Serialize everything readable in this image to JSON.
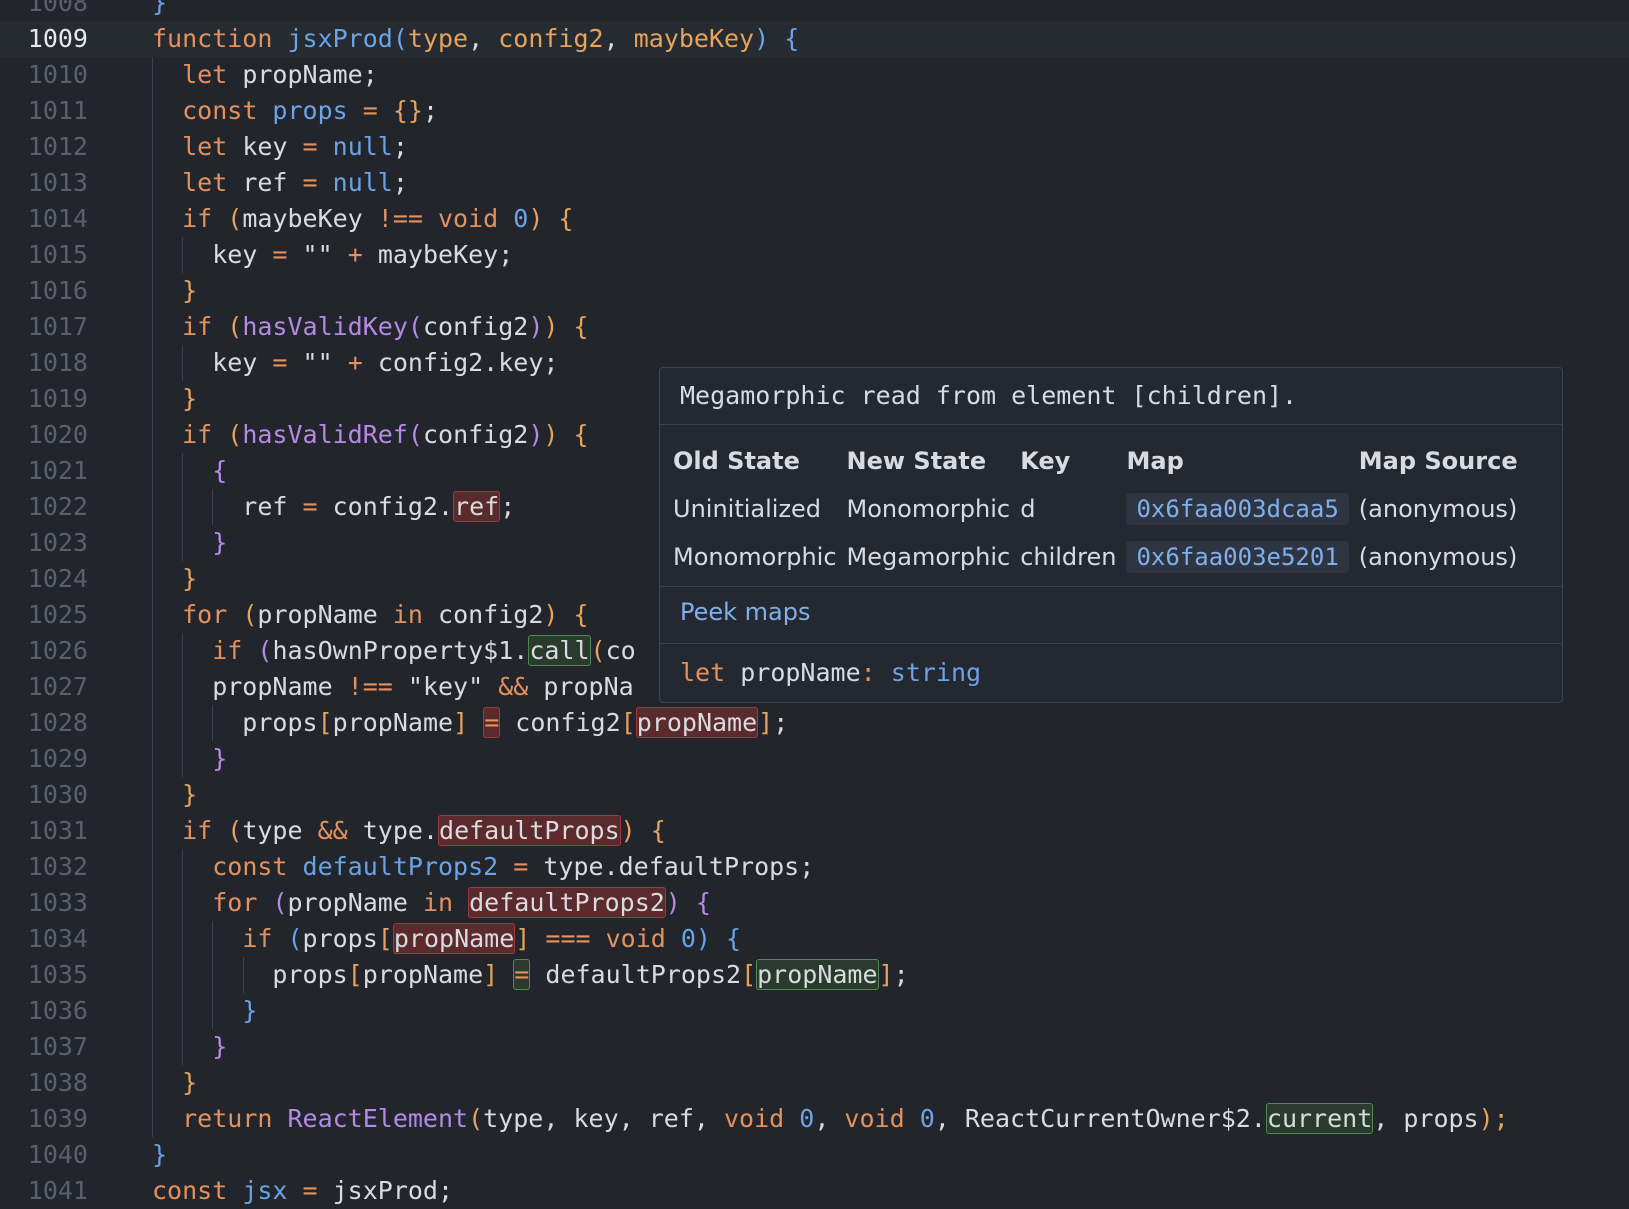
{
  "editor": {
    "current_line": 1009,
    "lines": [
      {
        "n": "1008",
        "code": [
          {
            "t": "}",
            "c": "fn"
          }
        ]
      },
      {
        "n": "1009",
        "code": [
          {
            "t": "function ",
            "c": "kw"
          },
          {
            "t": "jsxProd",
            "c": "fn"
          },
          {
            "t": "(",
            "c": "fn"
          },
          {
            "t": "type",
            "c": "pa"
          },
          {
            "t": ", "
          },
          {
            "t": "config2",
            "c": "pa"
          },
          {
            "t": ", "
          },
          {
            "t": "maybeKey",
            "c": "pa"
          },
          {
            "t": ") {",
            "c": "fn"
          }
        ]
      },
      {
        "n": "1010",
        "code": [
          {
            "t": "  "
          },
          {
            "t": "let",
            "c": "kw"
          },
          {
            "t": " propName;"
          }
        ]
      },
      {
        "n": "1011",
        "code": [
          {
            "t": "  "
          },
          {
            "t": "const ",
            "c": "kw"
          },
          {
            "t": "props",
            "c": "fn"
          },
          {
            "t": " = ",
            "c": "kw"
          },
          {
            "t": "{}",
            "c": "pa"
          },
          {
            "t": ";"
          }
        ]
      },
      {
        "n": "1012",
        "code": [
          {
            "t": "  "
          },
          {
            "t": "let",
            "c": "kw"
          },
          {
            "t": " key "
          },
          {
            "t": "=",
            "c": "kw"
          },
          {
            "t": " "
          },
          {
            "t": "null",
            "c": "num"
          },
          {
            "t": ";"
          }
        ]
      },
      {
        "n": "1013",
        "code": [
          {
            "t": "  "
          },
          {
            "t": "let",
            "c": "kw"
          },
          {
            "t": " ref "
          },
          {
            "t": "=",
            "c": "kw"
          },
          {
            "t": " "
          },
          {
            "t": "null",
            "c": "num"
          },
          {
            "t": ";"
          }
        ]
      },
      {
        "n": "1014",
        "code": [
          {
            "t": "  "
          },
          {
            "t": "if ",
            "c": "kw"
          },
          {
            "t": "(",
            "c": "pa"
          },
          {
            "t": "maybeKey "
          },
          {
            "t": "!== void ",
            "c": "kw"
          },
          {
            "t": "0",
            "c": "num"
          },
          {
            "t": ") {",
            "c": "pa"
          }
        ]
      },
      {
        "n": "1015",
        "code": [
          {
            "t": "    key "
          },
          {
            "t": "=",
            "c": "kw"
          },
          {
            "t": " \"\" "
          },
          {
            "t": "+",
            "c": "kw"
          },
          {
            "t": " maybeKey;"
          }
        ]
      },
      {
        "n": "1016",
        "code": [
          {
            "t": "  "
          },
          {
            "t": "}",
            "c": "pa"
          }
        ]
      },
      {
        "n": "1017",
        "code": [
          {
            "t": "  "
          },
          {
            "t": "if ",
            "c": "kw"
          },
          {
            "t": "(",
            "c": "pa"
          },
          {
            "t": "hasValidKey",
            "c": "fnp"
          },
          {
            "t": "(",
            "c": "fnp"
          },
          {
            "t": "config2"
          },
          {
            "t": ")",
            "c": "fnp"
          },
          {
            "t": ") {",
            "c": "pa"
          }
        ]
      },
      {
        "n": "1018",
        "code": [
          {
            "t": "    key "
          },
          {
            "t": "=",
            "c": "kw"
          },
          {
            "t": " \"\" "
          },
          {
            "t": "+",
            "c": "kw"
          },
          {
            "t": " config2.key;"
          }
        ]
      },
      {
        "n": "1019",
        "code": [
          {
            "t": "  "
          },
          {
            "t": "}",
            "c": "pa"
          }
        ]
      },
      {
        "n": "1020",
        "code": [
          {
            "t": "  "
          },
          {
            "t": "if ",
            "c": "kw"
          },
          {
            "t": "(",
            "c": "pa"
          },
          {
            "t": "hasValidRef",
            "c": "fnp"
          },
          {
            "t": "(",
            "c": "fnp"
          },
          {
            "t": "config2"
          },
          {
            "t": ")",
            "c": "fnp"
          },
          {
            "t": ") {",
            "c": "pa"
          }
        ]
      },
      {
        "n": "1021",
        "code": [
          {
            "t": "    "
          },
          {
            "t": "{",
            "c": "fnp"
          }
        ]
      },
      {
        "n": "1022",
        "code": [
          {
            "t": "      ref "
          },
          {
            "t": "=",
            "c": "kw"
          },
          {
            "t": " config2."
          },
          {
            "t": "ref",
            "h": "red"
          },
          {
            "t": ";"
          }
        ]
      },
      {
        "n": "1023",
        "code": [
          {
            "t": "    "
          },
          {
            "t": "}",
            "c": "fnp"
          }
        ]
      },
      {
        "n": "1024",
        "code": [
          {
            "t": "  "
          },
          {
            "t": "}",
            "c": "pa"
          }
        ]
      },
      {
        "n": "1025",
        "code": [
          {
            "t": "  "
          },
          {
            "t": "for ",
            "c": "kw"
          },
          {
            "t": "(",
            "c": "pa"
          },
          {
            "t": "propName "
          },
          {
            "t": "in",
            "c": "kw"
          },
          {
            "t": " config2"
          },
          {
            "t": ") {",
            "c": "pa"
          }
        ]
      },
      {
        "n": "1026",
        "code": [
          {
            "t": "    "
          },
          {
            "t": "if ",
            "c": "kw"
          },
          {
            "t": "(",
            "c": "fnp"
          },
          {
            "t": "hasOwnProperty$1."
          },
          {
            "t": "call",
            "h": "green"
          },
          {
            "t": "(",
            "c": "pa"
          },
          {
            "t": "co"
          }
        ]
      },
      {
        "n": "1027",
        "code": [
          {
            "t": "    propName "
          },
          {
            "t": "!== ",
            "c": "kw"
          },
          {
            "t": "\"key\" "
          },
          {
            "t": "&&",
            "c": "kw"
          },
          {
            "t": " propNa"
          }
        ]
      },
      {
        "n": "1028",
        "code": [
          {
            "t": "      props"
          },
          {
            "t": "[",
            "c": "pa"
          },
          {
            "t": "propName"
          },
          {
            "t": "]",
            "c": "pa"
          },
          {
            "t": " "
          },
          {
            "t": "=",
            "c": "kw",
            "h": "red"
          },
          {
            "t": " config2"
          },
          {
            "t": "[",
            "c": "pa"
          },
          {
            "t": "propName",
            "h": "red"
          },
          {
            "t": "]",
            "c": "pa"
          },
          {
            "t": ";"
          }
        ]
      },
      {
        "n": "1029",
        "code": [
          {
            "t": "    "
          },
          {
            "t": "}",
            "c": "fnp"
          }
        ]
      },
      {
        "n": "1030",
        "code": [
          {
            "t": "  "
          },
          {
            "t": "}",
            "c": "pa"
          }
        ]
      },
      {
        "n": "1031",
        "code": [
          {
            "t": "  "
          },
          {
            "t": "if ",
            "c": "kw"
          },
          {
            "t": "(",
            "c": "pa"
          },
          {
            "t": "type "
          },
          {
            "t": "&&",
            "c": "kw"
          },
          {
            "t": " type."
          },
          {
            "t": "defaultProps",
            "h": "red"
          },
          {
            "t": ") {",
            "c": "pa"
          }
        ]
      },
      {
        "n": "1032",
        "code": [
          {
            "t": "    "
          },
          {
            "t": "const ",
            "c": "kw"
          },
          {
            "t": "defaultProps2",
            "c": "fn"
          },
          {
            "t": " = ",
            "c": "kw"
          },
          {
            "t": "type.defaultProps;"
          }
        ]
      },
      {
        "n": "1033",
        "code": [
          {
            "t": "    "
          },
          {
            "t": "for ",
            "c": "kw"
          },
          {
            "t": "(",
            "c": "fnp"
          },
          {
            "t": "propName "
          },
          {
            "t": "in ",
            "c": "kw"
          },
          {
            "t": "defaultProps2",
            "h": "red"
          },
          {
            "t": ") {",
            "c": "fnp"
          }
        ]
      },
      {
        "n": "1034",
        "code": [
          {
            "t": "      "
          },
          {
            "t": "if ",
            "c": "kw"
          },
          {
            "t": "(",
            "c": "fn"
          },
          {
            "t": "props"
          },
          {
            "t": "[",
            "c": "pa"
          },
          {
            "t": "propName",
            "h": "red"
          },
          {
            "t": "]",
            "c": "pa"
          },
          {
            "t": " === void ",
            "c": "kw"
          },
          {
            "t": "0",
            "c": "num"
          },
          {
            "t": ") {",
            "c": "fn"
          }
        ]
      },
      {
        "n": "1035",
        "code": [
          {
            "t": "        props"
          },
          {
            "t": "[",
            "c": "pa"
          },
          {
            "t": "propName"
          },
          {
            "t": "]",
            "c": "pa"
          },
          {
            "t": " "
          },
          {
            "t": "=",
            "c": "kw",
            "h": "green"
          },
          {
            "t": " defaultProps2"
          },
          {
            "t": "[",
            "c": "pa"
          },
          {
            "t": "propName",
            "h": "green"
          },
          {
            "t": "]",
            "c": "pa"
          },
          {
            "t": ";"
          }
        ]
      },
      {
        "n": "1036",
        "code": [
          {
            "t": "      "
          },
          {
            "t": "}",
            "c": "fn"
          }
        ]
      },
      {
        "n": "1037",
        "code": [
          {
            "t": "    "
          },
          {
            "t": "}",
            "c": "fnp"
          }
        ]
      },
      {
        "n": "1038",
        "code": [
          {
            "t": "  "
          },
          {
            "t": "}",
            "c": "pa"
          }
        ]
      },
      {
        "n": "1039",
        "code": [
          {
            "t": "  "
          },
          {
            "t": "return ",
            "c": "kw"
          },
          {
            "t": "ReactElement",
            "c": "fnp"
          },
          {
            "t": "(",
            "c": "pa"
          },
          {
            "t": "type, key, ref, "
          },
          {
            "t": "void ",
            "c": "kw"
          },
          {
            "t": "0",
            "c": "num"
          },
          {
            "t": ", "
          },
          {
            "t": "void ",
            "c": "kw"
          },
          {
            "t": "0",
            "c": "num"
          },
          {
            "t": ", ReactCurrentOwner$2."
          },
          {
            "t": "current",
            "h": "green"
          },
          {
            "t": ", props"
          },
          {
            "t": ");",
            "c": "pa"
          }
        ]
      },
      {
        "n": "1040",
        "code": [
          {
            "t": "}",
            "c": "fn"
          }
        ]
      },
      {
        "n": "1041",
        "code": [
          {
            "t": "const ",
            "c": "kw"
          },
          {
            "t": "jsx",
            "c": "fn"
          },
          {
            "t": " = ",
            "c": "kw"
          },
          {
            "t": "jsxProd;"
          }
        ]
      }
    ]
  },
  "tooltip": {
    "title": "Megamorphic read from element [children].",
    "columns": [
      "Old State",
      "New State",
      "Key",
      "Map",
      "Map Source"
    ],
    "rows": [
      [
        "Uninitialized",
        "Monomorphic",
        "d",
        "0x6faa003dcaa5",
        "(anonymous)"
      ],
      [
        "Monomorphic",
        "Megamorphic",
        "children",
        "0x6faa003e5201",
        "(anonymous)"
      ]
    ],
    "peek_label": "Peek maps",
    "signature": {
      "keyword": "let",
      "name": "propName",
      "colon": ":",
      "type": "string"
    }
  }
}
